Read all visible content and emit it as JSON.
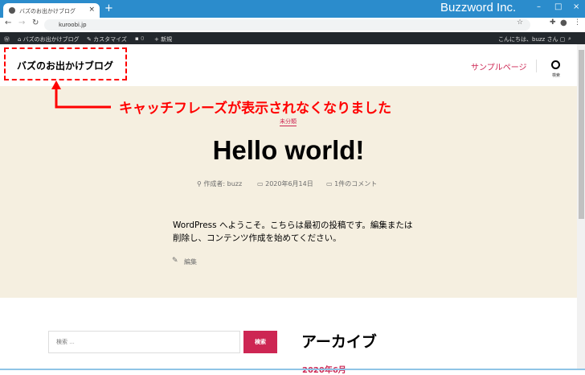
{
  "browser": {
    "tab_title": "バズのお出かけブログ",
    "url": "kuroobi.jp",
    "brand": "Buzzword Inc."
  },
  "admin_bar": {
    "site": "バズのお出かけブログ",
    "customize": "カスタマイズ",
    "comments": "0",
    "new": "新規",
    "greeting": "こんにちは、buzz さん"
  },
  "header": {
    "site_title": "バズのお出かけブログ",
    "nav": "サンプルページ",
    "search_label": "検索"
  },
  "post": {
    "category": "未分類",
    "title": "Hello world!",
    "author": "作成者: buzz",
    "date": "2020年6月14日",
    "comments": "1件のコメント",
    "body": "WordPress へようこそ。こちらは最初の投稿です。編集または削除し、コンテンツ作成を始めてください。",
    "edit": "編集"
  },
  "widgets": {
    "search_placeholder": "検索 …",
    "search_button": "検索",
    "archive_title": "アーカイブ",
    "archive_item": "2020年6月"
  },
  "annotation": {
    "text": "キャッチフレーズが表示されなくなりました",
    "color": "#ff0000"
  },
  "colors": {
    "accent": "#cd2653",
    "beige": "#f5efe0",
    "titlebar": "#2b8ccc"
  }
}
